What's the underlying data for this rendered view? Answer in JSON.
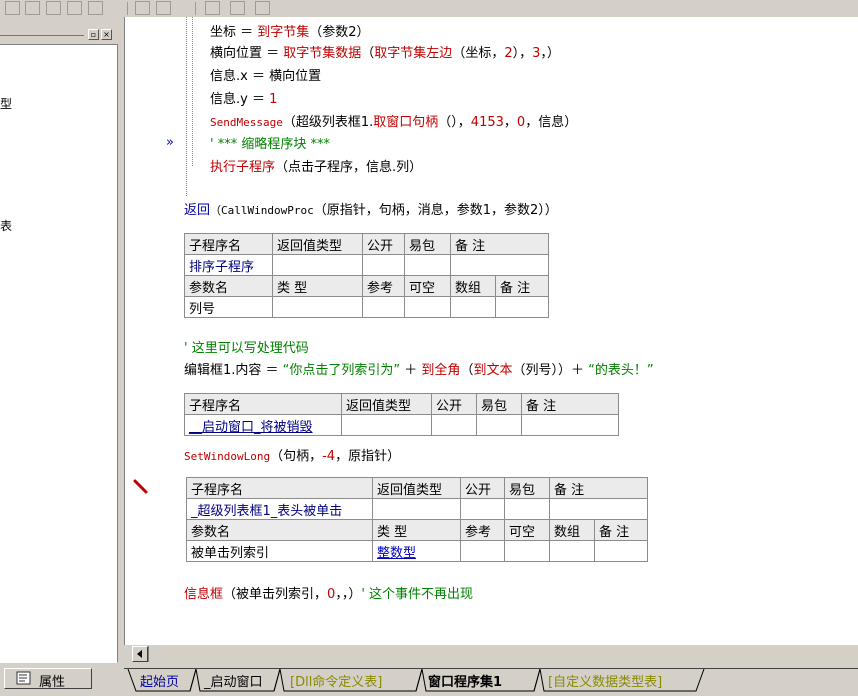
{
  "toolbar": {
    "icons": [
      "grid-icon",
      "merge-icon",
      "align-icon",
      "split-icon",
      "width-icon",
      "height-icon",
      "hspace-icon",
      "vspace-icon",
      "center-icon"
    ]
  },
  "left_panel": {
    "title_buttons": [
      "▫",
      "×"
    ],
    "visible_chars": [
      "型",
      "表"
    ]
  },
  "property_tab": {
    "icon": "properties-icon",
    "label": "属性"
  },
  "code_lines": {
    "l1": {
      "a": "坐标 ＝ ",
      "b": "到字节集",
      "c": "（参数2）"
    },
    "l2": {
      "a": "横向位置 ＝ ",
      "b": "取字节集数据",
      "c": "（",
      "d": "取字节集左边",
      "e": "（坐标，",
      "f": "2",
      "g": "），",
      "h": "3",
      "i": "，）"
    },
    "l3": {
      "a": "信息.x ＝ 横向位置"
    },
    "l4": {
      "a": "信息.y ＝ ",
      "b": "1"
    },
    "l5": {
      "a": "SendMessage",
      "b": "（超级列表框1.",
      "c": "取窗口句柄",
      "d": "（），",
      "e": "4153",
      "f": "，",
      "g": "0",
      "h": "，信息）"
    },
    "l6": {
      "a": "' *** 缩略程序块 ***"
    },
    "l7": {
      "a": "执行子程序",
      "b": "（点击子程序，信息.列）"
    },
    "l8": {
      "a": "返回",
      "b": "（CallWindowProc",
      "c": "（原指针，句柄，消息，参数1，参数2））"
    },
    "comment1": "' 这里可以写处理代码",
    "l9": {
      "a": "编辑框1.内容 ＝ ",
      "b": "“你点击了列索引为”",
      "c": " ＋ ",
      "d": "到全角",
      "e": "（",
      "f": "到文本",
      "g": "（列号））＋ ",
      "h": "“的表头！”"
    },
    "l10": {
      "a": "SetWindowLong",
      "b": "（句柄，",
      "c": "-4",
      "d": "，原指针）"
    },
    "l11": {
      "a": "信息框",
      "b": "（被单击列索引，",
      "c": "0",
      "d": "，，）",
      "e": "' 这个事件不再出现"
    }
  },
  "table1": {
    "h": [
      "子程序名",
      "返回值类型",
      "公开",
      "易包",
      "备 注"
    ],
    "r": [
      "排序子程序",
      "",
      "",
      "",
      ""
    ],
    "ph": [
      "参数名",
      "类 型",
      "参考",
      "可空",
      "数组",
      "备 注"
    ],
    "pr": [
      "列号",
      "",
      "",
      "",
      "",
      ""
    ]
  },
  "table2": {
    "h": [
      "子程序名",
      "返回值类型",
      "公开",
      "易包",
      "备 注"
    ],
    "r": [
      "__启动窗口_将被销毁",
      "",
      "",
      "",
      ""
    ]
  },
  "table3": {
    "h": [
      "子程序名",
      "返回值类型",
      "公开",
      "易包",
      "备 注"
    ],
    "r": [
      "_超级列表框1_表头被单击",
      "",
      "",
      "",
      ""
    ],
    "ph": [
      "参数名",
      "类 型",
      "参考",
      "可空",
      "数组",
      "备 注"
    ],
    "pr": [
      "被单击列索引",
      "整数型",
      "",
      "",
      "",
      ""
    ]
  },
  "tabs": [
    "起始页",
    "_启动窗口",
    "[Dll命令定义表]",
    "窗口程序集1",
    "[自定义数据类型表]"
  ]
}
